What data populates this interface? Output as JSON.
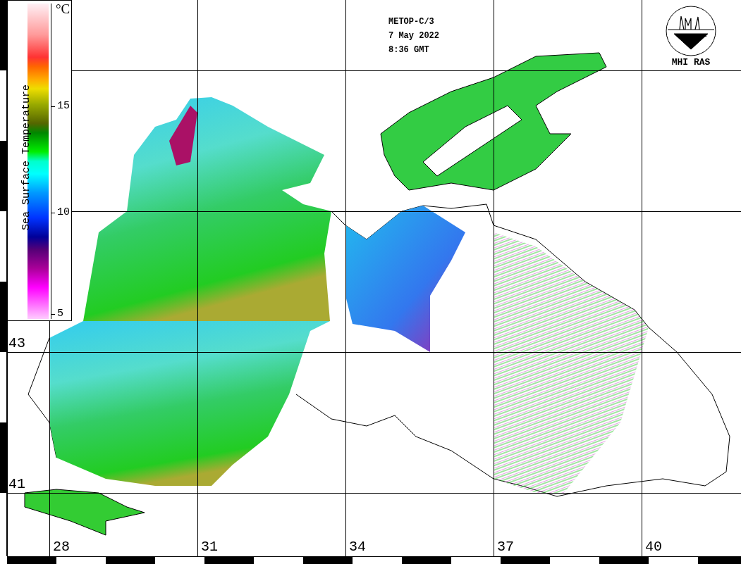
{
  "colorbar": {
    "unit": "°C",
    "title": "Sea Surface Temperature",
    "ticks": [
      "15",
      "10",
      "5"
    ]
  },
  "header": [
    "METOP-C/3",
    "7 May 2022",
    "8:36 GMT"
  ],
  "logo": {
    "text": "MHI RAS"
  },
  "latitude_labels": [
    "43",
    "41"
  ],
  "longitude_labels": [
    "28",
    "31",
    "34",
    "37",
    "40"
  ]
}
